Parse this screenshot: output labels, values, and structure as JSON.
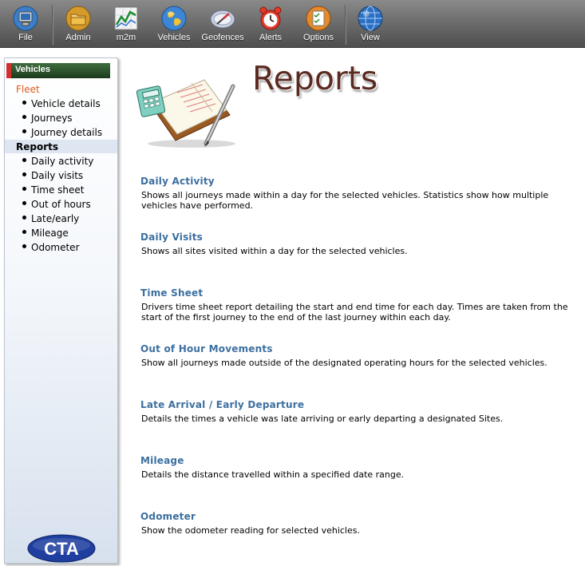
{
  "toolbar": {
    "buttons": [
      {
        "label": "File",
        "icon": "computer-monitor-icon"
      },
      {
        "label": "Admin",
        "icon": "folder-icon"
      },
      {
        "label": "m2m",
        "icon": "line-chart-icon"
      },
      {
        "label": "Vehicles",
        "icon": "globe-icon"
      },
      {
        "label": "Geofences",
        "icon": "compass-icon"
      },
      {
        "label": "Alerts",
        "icon": "alarm-clock-icon"
      },
      {
        "label": "Options",
        "icon": "checklist-icon"
      },
      {
        "label": "View",
        "icon": "globe-view-icon"
      }
    ]
  },
  "sidebar": {
    "header": "Vehicles",
    "fleet_label": "Fleet",
    "fleet_items": [
      "Vehicle details",
      "Journeys",
      "Journey details"
    ],
    "reports_label": "Reports",
    "report_items": [
      "Daily activity",
      "Daily visits",
      "Time sheet",
      "Out of hours",
      "Late/early",
      "Mileage",
      "Odometer"
    ],
    "logo_text": "CTA"
  },
  "main": {
    "title": "Reports",
    "reports": [
      {
        "title": "Daily Activity",
        "description": "Shows all journeys made within a day for the selected vehicles. Statistics show how multiple vehicles have performed."
      },
      {
        "title": "Daily Visits",
        "description": "Shows all sites visited within a day for the selected vehicles."
      },
      {
        "title": "Time Sheet",
        "description": "Drivers time sheet report detailing the start and end time for each day. Times are taken from the start of the first journey to the end of the last journey within each day."
      },
      {
        "title": "Out of Hour Movements",
        "description": "Show all journeys made outside of the designated operating hours for the selected vehicles."
      },
      {
        "title": "Late Arrival / Early Departure",
        "description": "Details the times a vehicle was late arriving or early departing a designated Sites."
      },
      {
        "title": "Mileage",
        "description": "Details the distance travelled within a specified date range."
      },
      {
        "title": "Odometer",
        "description": "Show the odometer reading for selected vehicles."
      }
    ]
  },
  "colors": {
    "accent_link": "#3c6fa0",
    "fleet_label": "#e05a1e",
    "title": "#5b2a21",
    "sidebar_header": "#2e5530"
  }
}
